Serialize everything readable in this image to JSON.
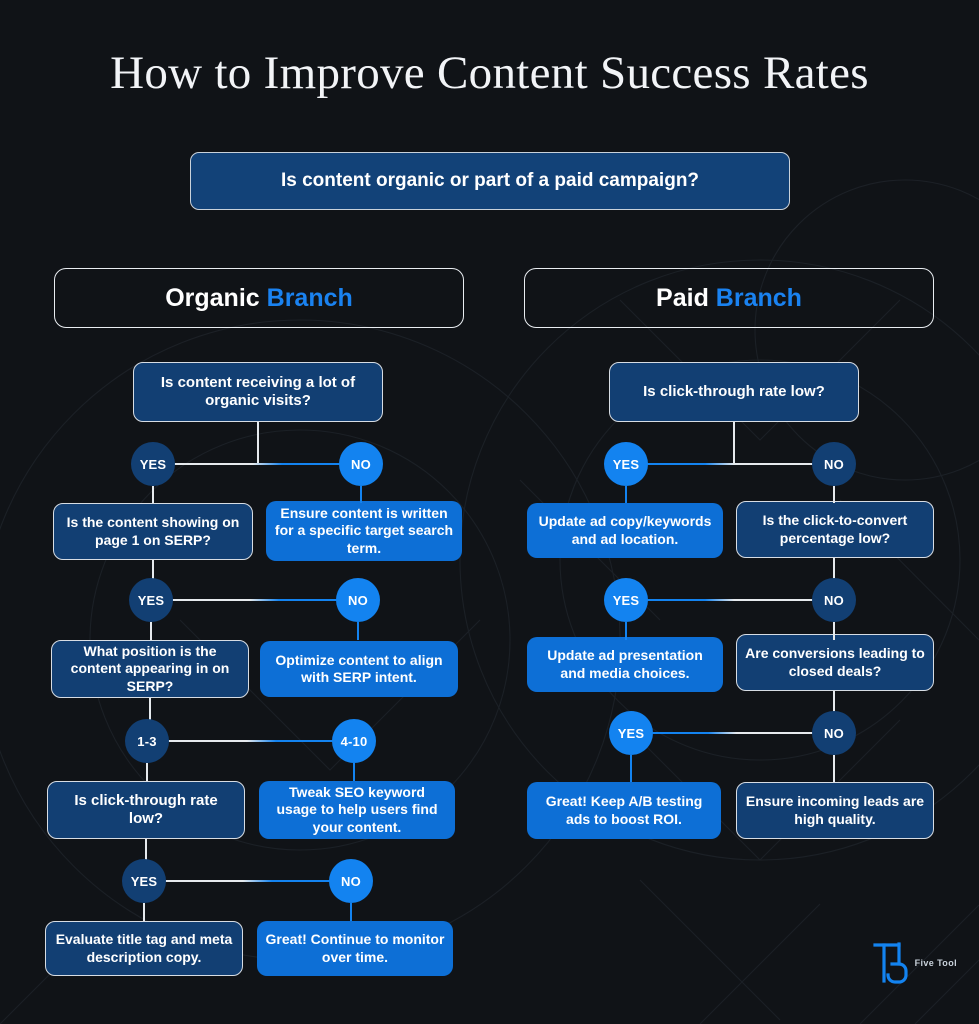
{
  "page": {
    "title": "How to Improve Content Success Rates",
    "background_color": "#101317",
    "navy_color": "#123f73",
    "bright_blue_color": "#0d6fd6",
    "accent_color": "#1a82f0"
  },
  "root": {
    "text": "Is content organic or part of a paid campaign?"
  },
  "branches": [
    {
      "id": "organic",
      "header_primary": "Organic",
      "header_accent": "Branch",
      "rows": [
        {
          "question": "Is content receiving a lot of organic visits?",
          "left_label": "YES",
          "right_label": "NO",
          "answer": "Ensure content is written for a specific target search term."
        },
        {
          "question": "Is the content showing on page 1 on SERP?",
          "left_label": "YES",
          "right_label": "NO",
          "answer": "Optimize content to align with SERP intent."
        },
        {
          "question": "What position is the content appearing in on SERP?",
          "left_label": "1-3",
          "right_label": "4-10",
          "answer": "Tweak SEO keyword usage to help users find your content."
        },
        {
          "question": "Is click-through rate low?",
          "left_label": "YES",
          "right_label": "NO",
          "answer": "Great! Continue to monitor over time."
        }
      ],
      "terminal": "Evaluate title tag and meta description copy."
    },
    {
      "id": "paid",
      "header_primary": "Paid",
      "header_accent": "Branch",
      "rows": [
        {
          "question": "Is click-through rate low?",
          "left_label": "YES",
          "right_label": "NO",
          "answer": "Update ad copy/keywords and ad location."
        },
        {
          "question": "Is the click-to-convert percentage low?",
          "left_label": "YES",
          "right_label": "NO",
          "answer": "Update ad presentation and media choices."
        },
        {
          "question": "Are conversions leading to closed deals?",
          "left_label": "YES",
          "right_label": "NO",
          "answer": "Great! Keep A/B testing ads to boost ROI."
        }
      ],
      "terminal": "Ensure incoming leads are high quality."
    }
  ],
  "logo": {
    "mark": "T5",
    "text": "Five Tool"
  }
}
